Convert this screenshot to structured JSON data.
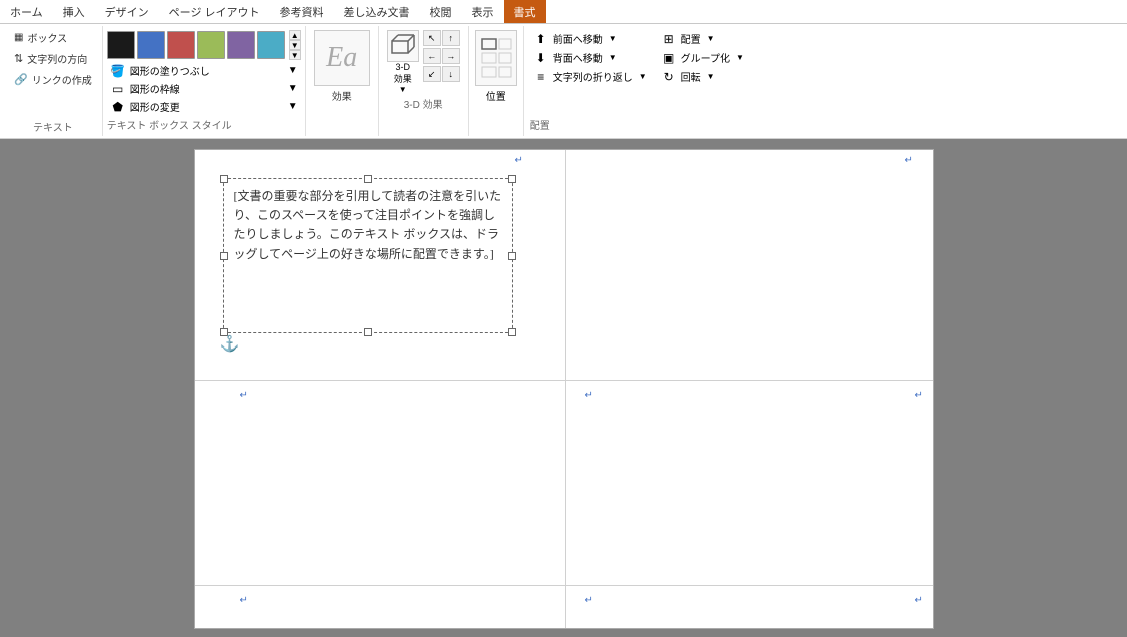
{
  "ribbon": {
    "tabs": [
      {
        "label": "ホーム",
        "active": false
      },
      {
        "label": "挿入",
        "active": false
      },
      {
        "label": "デザイン",
        "active": false
      },
      {
        "label": "ページ レイアウト",
        "active": false
      },
      {
        "label": "参考資料",
        "active": false
      },
      {
        "label": "差し込み文書",
        "active": false
      },
      {
        "label": "校閲",
        "active": false
      },
      {
        "label": "表示",
        "active": false
      },
      {
        "label": "書式",
        "active": true
      }
    ],
    "groups": {
      "text": {
        "label": "テキスト",
        "direction_btn": "文字列の方向",
        "link_btn": "リンクの作成",
        "textbox_btn": "ボックス"
      },
      "style": {
        "label": "テキスト ボックス スタイル",
        "fill_cmd": "図形の塗りつぶし",
        "border_cmd": "図形の枠線",
        "change_cmd": "図形の変更",
        "swatches": [
          "black",
          "blue",
          "red",
          "green",
          "purple",
          "teal"
        ]
      },
      "effect": {
        "label": "効果",
        "btn_label": "効果"
      },
      "threed": {
        "label": "3-D 効果",
        "btn1": "3-D\n効果",
        "btn2": ""
      },
      "position": {
        "label": "位置",
        "btn_label": "位置"
      },
      "arrange": {
        "label": "配置",
        "items": [
          "前面へ移動",
          "背面へ移動",
          "文字列の折り返し",
          "配置",
          "グループ化",
          "回転"
        ]
      }
    }
  },
  "document": {
    "textbox_content": "[文書の重要な部分を引用して読者の注意を引いたり、このスペースを使って注目ポイントを強調したりしましょう。このテキスト ボックスは、ドラッグしてページ上の好きな場所に配置できます。]"
  }
}
